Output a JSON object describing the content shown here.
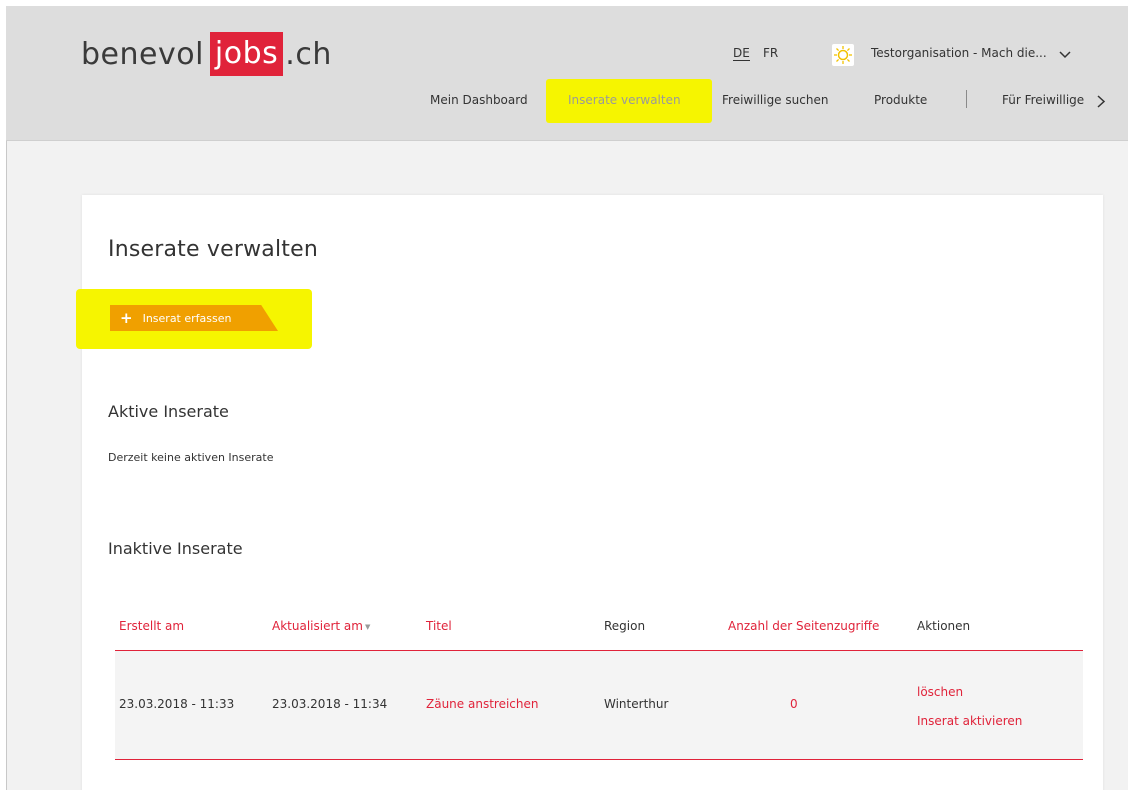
{
  "logo": {
    "part1": "benevol",
    "part2": "jobs",
    "part3": ".ch"
  },
  "header": {
    "languages": [
      "DE",
      "FR"
    ],
    "active_language": "DE",
    "organization": "Testorganisation - Mach die...",
    "nav": [
      "Mein Dashboard",
      "Inserate verwalten",
      "Freiwillige suchen",
      "Produkte",
      "Für Freiwillige"
    ],
    "active_nav": "Inserate verwalten"
  },
  "page": {
    "title": "Inserate verwalten",
    "add_button": "Inserat erfassen",
    "active_section": "Aktive Inserate",
    "active_empty": "Derzeit keine aktiven Inserate",
    "inactive_section": "Inaktive Inserate"
  },
  "table": {
    "columns": [
      "Erstellt am",
      "Aktualisiert am",
      "Titel",
      "Region",
      "Anzahl der Seitenzugriffe",
      "Aktionen"
    ],
    "rows": [
      {
        "created": "23.03.2018 - 11:33",
        "updated": "23.03.2018 - 11:34",
        "title": "Zäune anstreichen",
        "region": "Winterthur",
        "views": "0",
        "actions": [
          "löschen",
          "Inserat aktivieren"
        ]
      }
    ]
  },
  "colors": {
    "brand_red": "#e0233a",
    "button_orange": "#f0a000",
    "highlight_yellow": "#f6f500"
  }
}
